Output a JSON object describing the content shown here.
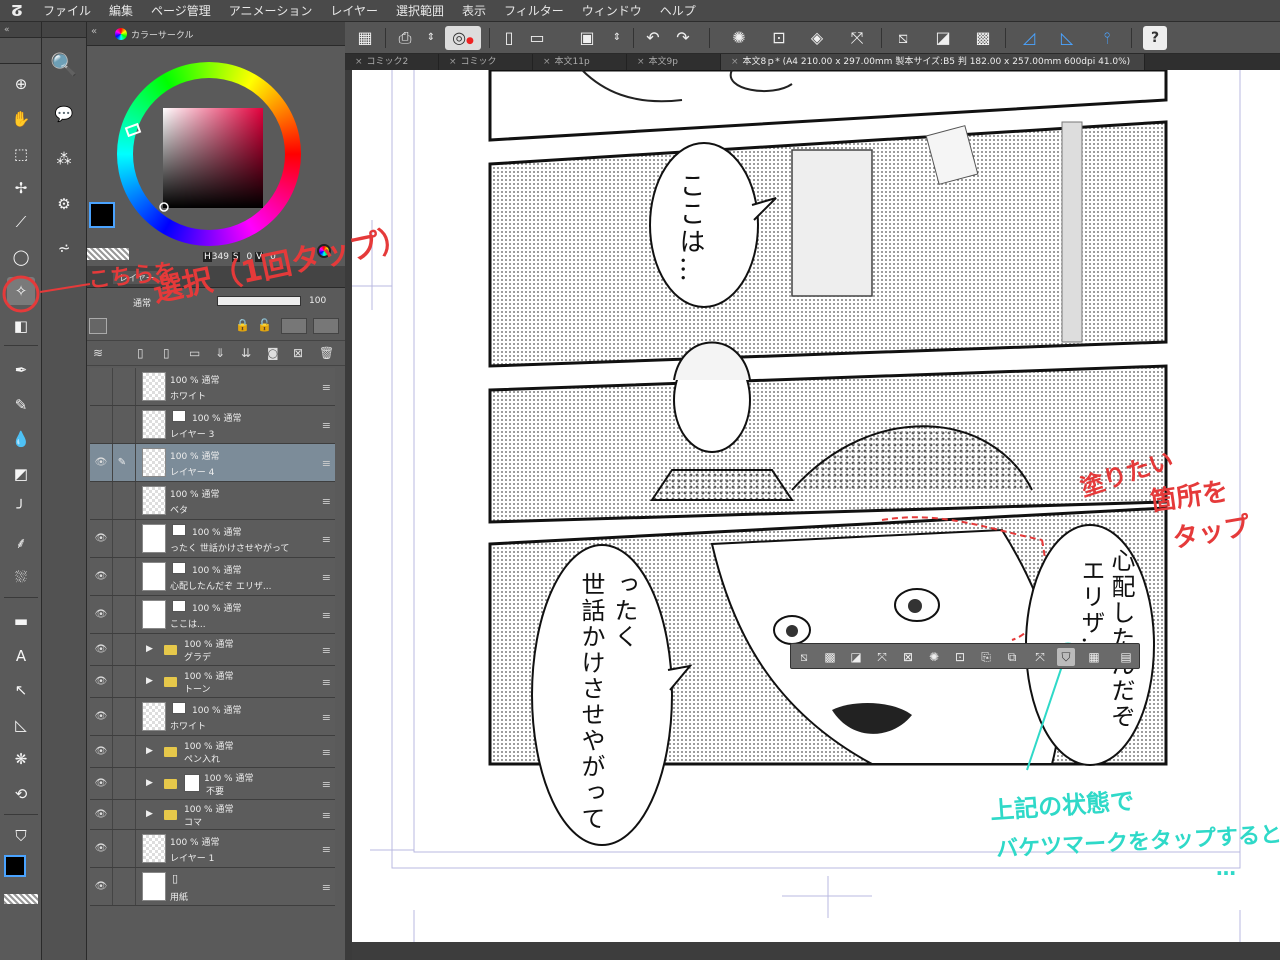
{
  "menu": {
    "items": [
      "ファイル",
      "編集",
      "ページ管理",
      "アニメーション",
      "レイヤー",
      "選択範囲",
      "表示",
      "フィルター",
      "ウィンドウ",
      "ヘルプ"
    ]
  },
  "tabs": {
    "items": [
      "コミック2",
      "コミック",
      "本文11p",
      "本文9p"
    ],
    "active": "本文8ｐ* (A4 210.00 x 297.00mm 製本サイズ:B5 判 182.00 x 257.00mm 600dpi 41.0%)"
  },
  "color_panel": {
    "title": "カラーサークル",
    "hue": "349",
    "s": "0",
    "v": "0",
    "h_label": "H",
    "s_label": "S",
    "v_label": "V",
    "main_color": "#000000",
    "sub_color": "#ffffff"
  },
  "layer_panel": {
    "tab": "レイヤー",
    "blend_mode": "通常",
    "opacity": "100",
    "layers": [
      {
        "mode": "100 % 通常",
        "name": "ホワイト",
        "visible": false,
        "type": "raster"
      },
      {
        "mode": "100 % 通常",
        "name": "レイヤー 3",
        "visible": false,
        "type": "raster-mask"
      },
      {
        "mode": "100 % 通常",
        "name": "レイヤー 4",
        "visible": true,
        "selected": true,
        "editing": true,
        "type": "raster"
      },
      {
        "mode": "100 % 通常",
        "name": "ベタ",
        "visible": false,
        "type": "raster"
      },
      {
        "mode": "100 % 通常",
        "name": "ったく 世話かけさせやがって",
        "visible": true,
        "type": "text"
      },
      {
        "mode": "100 % 通常",
        "name": "心配したんだぞ エリザ...",
        "visible": true,
        "type": "text"
      },
      {
        "mode": "100 % 通常",
        "name": "ここは...",
        "visible": true,
        "type": "text"
      },
      {
        "mode": "100 % 通常",
        "name": "グラデ",
        "visible": true,
        "type": "folder"
      },
      {
        "mode": "100 % 通常",
        "name": "トーン",
        "visible": true,
        "type": "folder"
      },
      {
        "mode": "100 % 通常",
        "name": "ホワイト",
        "visible": true,
        "type": "raster-mask"
      },
      {
        "mode": "100 % 通常",
        "name": "ペン入れ",
        "visible": true,
        "type": "folder"
      },
      {
        "mode": "100 % 通常",
        "name": "不要",
        "visible": true,
        "type": "folder-mask"
      },
      {
        "mode": "100 % 通常",
        "name": "コマ",
        "visible": true,
        "type": "folder"
      },
      {
        "mode": "100 % 通常",
        "name": "レイヤー 1",
        "visible": true,
        "type": "raster"
      },
      {
        "mode": "",
        "name": "用紙",
        "visible": true,
        "type": "paper"
      }
    ]
  },
  "canvas": {
    "balloons": {
      "b1": "ここは…",
      "b2_col1": "心配したんだぞ",
      "b2_col2": "エリザ…",
      "b3_col1": "ったく",
      "b3_col2": "世話かけさせやがって"
    }
  },
  "annotations": {
    "red_top_line1": "こちらを",
    "red_top_line2": "選択（1回タップ）",
    "red_right_line1": "塗りたい",
    "red_right_line2": "箇所を",
    "red_right_line3": "タップ",
    "cyan_line1": "上記の状態で",
    "cyan_line2": "バケツマークをタップすると",
    "cyan_line3": "…",
    "red_color": "#e53a3a",
    "cyan_color": "#2fd9c8"
  }
}
